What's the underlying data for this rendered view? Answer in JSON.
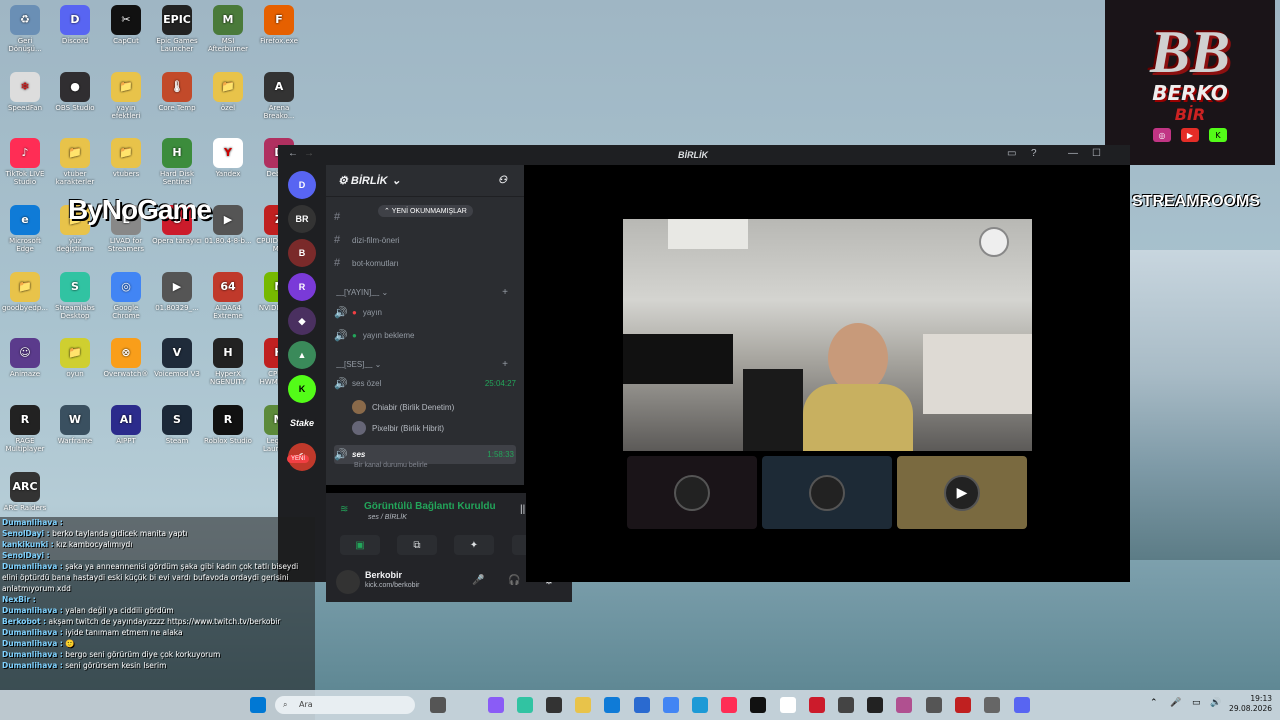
{
  "desktop": {
    "icons": [
      {
        "label": "Geri Dönüşü...",
        "color": "#6a8fb5",
        "glyph": "♻"
      },
      {
        "label": "Discord",
        "color": "#5865f2",
        "glyph": "D"
      },
      {
        "label": "CapCut",
        "color": "#111111",
        "glyph": "✂"
      },
      {
        "label": "Epic Games Launcher",
        "color": "#222222",
        "glyph": "EPIC"
      },
      {
        "label": "MSI Afterburner",
        "color": "#4a7a3a",
        "glyph": "M"
      },
      {
        "label": "Firefox.exe",
        "color": "#e66000",
        "glyph": "F"
      },
      {
        "label": "SpeedFan",
        "color": "#dddddd",
        "glyph": "❄"
      },
      {
        "label": "OBS Studio",
        "color": "#302e31",
        "glyph": "●"
      },
      {
        "label": "yayın efektleri",
        "color": "#e8c34a",
        "glyph": "📁"
      },
      {
        "label": "Core Temp",
        "color": "#c24a2a",
        "glyph": "🌡"
      },
      {
        "label": "özel",
        "color": "#e8c34a",
        "glyph": "📁"
      },
      {
        "label": "Arena Breako...",
        "color": "#333333",
        "glyph": "A"
      },
      {
        "label": "TikTok LIVE Studio",
        "color": "#ff2d55",
        "glyph": "♪"
      },
      {
        "label": "vtuber karakterler",
        "color": "#e8c34a",
        "glyph": "📁"
      },
      {
        "label": "vtubers",
        "color": "#e8c34a",
        "glyph": "📁"
      },
      {
        "label": "Hard Disk Sentinel",
        "color": "#3c8c3c",
        "glyph": "H"
      },
      {
        "label": "Yandex",
        "color": "#ffffff",
        "glyph": "Y"
      },
      {
        "label": "Debu...",
        "color": "#b03060",
        "glyph": "D"
      },
      {
        "label": "Microsoft Edge",
        "color": "#0f7bd7",
        "glyph": "e"
      },
      {
        "label": "yüz değiştirme",
        "color": "#e8c34a",
        "glyph": "📁"
      },
      {
        "label": "LIVAD for Streamers",
        "color": "#888888",
        "glyph": "L"
      },
      {
        "label": "Opera tarayıcı",
        "color": "#cc1b2b",
        "glyph": "O"
      },
      {
        "label": "01.80.4-8-b...",
        "color": "#555555",
        "glyph": "▶"
      },
      {
        "label": "CPUID CPU-Z MSI",
        "color": "#c02020",
        "glyph": "Z"
      },
      {
        "label": "goodbyedp...",
        "color": "#e8c34a",
        "glyph": "📁"
      },
      {
        "label": "Streamlabs Desktop",
        "color": "#31c3a2",
        "glyph": "S"
      },
      {
        "label": "Google Chrome",
        "color": "#4285f4",
        "glyph": "◎"
      },
      {
        "label": "01.80329_...",
        "color": "#555555",
        "glyph": "▶"
      },
      {
        "label": "AIDA64 Extreme",
        "color": "#c0392b",
        "glyph": "64"
      },
      {
        "label": "NVIDIA App",
        "color": "#76b900",
        "glyph": "N"
      },
      {
        "label": "Animaze",
        "color": "#5b3b8c",
        "glyph": "☺"
      },
      {
        "label": "oyun",
        "color": "#cfcf30",
        "glyph": "📁"
      },
      {
        "label": "Overwatch®",
        "color": "#f99e1a",
        "glyph": "⊗"
      },
      {
        "label": "Voicemod V3",
        "color": "#1f2b3a",
        "glyph": "V"
      },
      {
        "label": "HyperX NGENUITY",
        "color": "#222222",
        "glyph": "H"
      },
      {
        "label": "CPUID HWMonitor",
        "color": "#c02020",
        "glyph": "H"
      },
      {
        "label": "RAGE Multiplayer",
        "color": "#222222",
        "glyph": "R"
      },
      {
        "label": "Warframe",
        "color": "#3a5060",
        "glyph": "W"
      },
      {
        "label": "AIPPT",
        "color": "#2b2b8c",
        "glyph": "AI"
      },
      {
        "label": "Steam",
        "color": "#1b2838",
        "glyph": "S"
      },
      {
        "label": "Roblox Studio",
        "color": "#111111",
        "glyph": "R"
      },
      {
        "label": "Legacy Launch...",
        "color": "#5c8a3a",
        "glyph": "M"
      },
      {
        "label": "ARC Raiders",
        "color": "#333333",
        "glyph": "ARC"
      }
    ],
    "overlay_text": "ByNoGame",
    "logo": {
      "bb": "BB",
      "name": "BERKO",
      "sub": "BİR"
    },
    "streamrooms": "STREAMROOMS"
  },
  "discord": {
    "window_title": "BİRLİK",
    "guild_name": "BİRLİK",
    "new_unread": "YENİ OKUNMAMIŞLAR",
    "channels": [
      {
        "sym": "#",
        "label": "dizi-film-öneri"
      },
      {
        "sym": "#",
        "label": "bot-komutları"
      }
    ],
    "cat_yayin": "﹏[YAYIN]﹏",
    "yayin_channels": [
      "yayın",
      "yayın bekleme"
    ],
    "cat_ses": "﹏[SES]﹏",
    "ses_ozel": {
      "label": "ses özel",
      "timer": "25:04:27"
    },
    "users": [
      {
        "name": "Chiabir (Birlik Denetim)"
      },
      {
        "name": "Pixelbir (Birlik Hibrit)"
      }
    ],
    "ses_active": {
      "label": "ses",
      "timer": "1:58:33",
      "status": "Bir kanal durumu belirle"
    },
    "voice_connected": "Görüntülü Bağlantı Kuruldu",
    "voice_sub": "ses / BİRLİK",
    "user_name": "Berkobir",
    "user_sub": "kick.com/berkobir",
    "new_badge": "YENİ"
  },
  "chat": [
    {
      "n": "Dumanlihava :",
      "t": ""
    },
    {
      "n": "SenolDayi :",
      "t": " berko taylanda gidicek manita yaptı"
    },
    {
      "n": "kankikunki :",
      "t": " kız kambocyalımıydı"
    },
    {
      "n": "SenolDayi :",
      "t": ""
    },
    {
      "n": "Dumanlihava :",
      "t": " şaka ya anneannenisi gördüm şaka gibi kadın çok tatlı biseydi"
    },
    {
      "n": "",
      "t": "elini öptürdü bana hastaydi eski küçük bi evi vardı bufavoda ordaydi gerisini"
    },
    {
      "n": "",
      "t": "anlatmıyorum xdd"
    },
    {
      "n": "NexBir :",
      "t": ""
    },
    {
      "n": "Dumanlihava :",
      "t": " yalan değil ya ciddili gördüm"
    },
    {
      "n": "Berkobot :",
      "t": " akşam twitch de yayındayızzzz https://www.twitch.tv/berkobir"
    },
    {
      "n": "Dumanlihava :",
      "t": " iyide tanımam etmem ne alaka"
    },
    {
      "n": "Dumanlihava :",
      "t": " 🙂"
    },
    {
      "n": "Dumanlihava :",
      "t": " bergo seni görürüm diye çok korkuyorum"
    },
    {
      "n": "Dumanlihava :",
      "t": " seni görürsem kesin lserim"
    }
  ],
  "taskbar": {
    "search": "Ara",
    "time": "19:13",
    "date": "29.08.2026"
  }
}
